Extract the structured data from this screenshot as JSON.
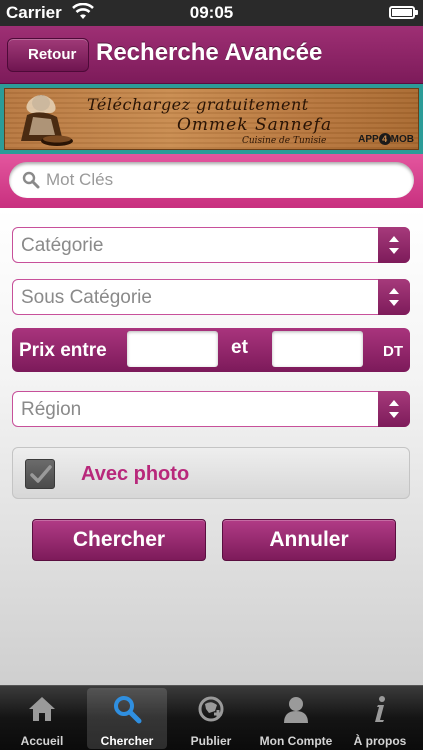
{
  "status_bar": {
    "carrier": "Carrier",
    "time": "09:05"
  },
  "nav": {
    "back_label": "Retour",
    "title": "Recherche Avancée"
  },
  "banner": {
    "line1": "Téléchargez gratuitement",
    "line2": "Ommek Sannefa",
    "line3": "Cuisine de Tunisie",
    "logo_pre": "APP",
    "logo_mid": "4",
    "logo_post": "MOB"
  },
  "search": {
    "placeholder": "Mot Clés"
  },
  "form": {
    "category": "Catégorie",
    "subcategory": "Sous Catégorie",
    "price_label": "Prix entre",
    "price_and": "et",
    "price_unit": "DT",
    "price_min": "",
    "price_max": "",
    "region": "Région",
    "photo_label": "Avec photo",
    "photo_checked": true
  },
  "buttons": {
    "search": "Chercher",
    "cancel": "Annuler"
  },
  "tabbar": {
    "items": [
      {
        "label": "Accueil",
        "icon": "home-icon"
      },
      {
        "label": "Chercher",
        "icon": "search-icon",
        "active": true
      },
      {
        "label": "Publier",
        "icon": "publish-icon"
      },
      {
        "label": "Mon Compte",
        "icon": "user-icon"
      },
      {
        "label": "À propos",
        "icon": "info-icon"
      }
    ]
  },
  "colors": {
    "accent": "#8e2467",
    "accent_light": "#d63f8e",
    "teal": "#2c9c98"
  }
}
